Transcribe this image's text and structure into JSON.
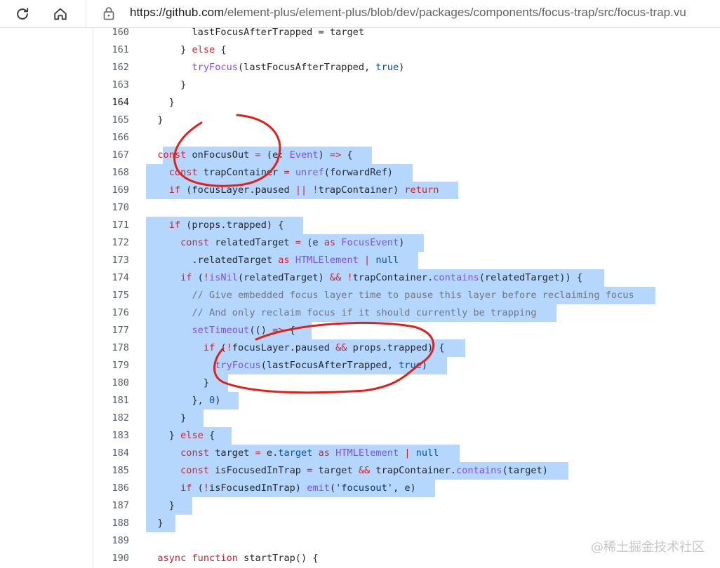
{
  "browser": {
    "url_host": "https://github.com",
    "url_path": "/element-plus/element-plus/blob/dev/packages/components/focus-trap/src/focus-trap.vu",
    "icons": {
      "reload": "reload-icon",
      "home": "home-icon",
      "lock": "lock-icon"
    }
  },
  "code": {
    "lines": [
      {
        "n": "160",
        "tokens": [
          [
            "",
            "        lastFocusAfterTrapped = target"
          ]
        ]
      },
      {
        "n": "161",
        "tokens": [
          [
            "",
            "      } "
          ],
          [
            "kw",
            "else"
          ],
          [
            "",
            " {"
          ]
        ]
      },
      {
        "n": "162",
        "tokens": [
          [
            "",
            "        "
          ],
          [
            "fn",
            "tryFocus"
          ],
          [
            "",
            "(lastFocusAfterTrapped, "
          ],
          [
            "ct",
            "true"
          ],
          [
            "",
            ")"
          ]
        ]
      },
      {
        "n": "163",
        "tokens": [
          [
            "",
            "      }"
          ]
        ]
      },
      {
        "n": "164",
        "current": true,
        "tokens": [
          [
            "",
            "    }"
          ]
        ]
      },
      {
        "n": "165",
        "tokens": [
          [
            "",
            "  }"
          ]
        ]
      },
      {
        "n": "166",
        "tokens": []
      },
      {
        "n": "167",
        "hl": [
          232,
          530
        ],
        "tokens": [
          [
            "",
            "  "
          ],
          [
            "kw",
            "const"
          ],
          [
            "",
            " onFocusOut "
          ],
          [
            "kw",
            "="
          ],
          [
            "",
            " (e: "
          ],
          [
            "fn",
            "Event"
          ],
          [
            "",
            ") "
          ],
          [
            "kw",
            "=>"
          ],
          [
            "",
            " {"
          ]
        ]
      },
      {
        "n": "168",
        "hl": [
          208,
          588
        ],
        "tokens": [
          [
            "",
            "    "
          ],
          [
            "kw",
            "const"
          ],
          [
            "",
            " trapContainer "
          ],
          [
            "kw",
            "="
          ],
          [
            "",
            " "
          ],
          [
            "fn",
            "unref"
          ],
          [
            "",
            "(forwardRef)"
          ]
        ]
      },
      {
        "n": "169",
        "hl": [
          208,
          653
        ],
        "tokens": [
          [
            "",
            "    "
          ],
          [
            "kw",
            "if"
          ],
          [
            "",
            " (focusLayer.paused "
          ],
          [
            "kw",
            "||"
          ],
          [
            "",
            " "
          ],
          [
            "kw",
            "!"
          ],
          [
            "",
            "trapContainer) "
          ],
          [
            "kw",
            "return"
          ]
        ]
      },
      {
        "n": "170",
        "tokens": []
      },
      {
        "n": "171",
        "hl": [
          208,
          432
        ],
        "tokens": [
          [
            "",
            "    "
          ],
          [
            "kw",
            "if"
          ],
          [
            "",
            " (props.trapped) {"
          ]
        ]
      },
      {
        "n": "172",
        "hl": [
          208,
          604
        ],
        "tokens": [
          [
            "",
            "      "
          ],
          [
            "kw",
            "const"
          ],
          [
            "",
            " relatedTarget "
          ],
          [
            "kw",
            "="
          ],
          [
            "",
            " (e "
          ],
          [
            "kw",
            "as"
          ],
          [
            "",
            " "
          ],
          [
            "fn",
            "FocusEvent"
          ],
          [
            "",
            ")"
          ]
        ]
      },
      {
        "n": "173",
        "hl": [
          208,
          596
        ],
        "tokens": [
          [
            "",
            "        .relatedTarget "
          ],
          [
            "kw",
            "as"
          ],
          [
            "",
            " "
          ],
          [
            "fn",
            "HTMLElement"
          ],
          [
            "",
            " "
          ],
          [
            "kw",
            "|"
          ],
          [
            "",
            " "
          ],
          [
            "ct",
            "null"
          ]
        ]
      },
      {
        "n": "174",
        "hl": [
          208,
          861
        ],
        "tokens": [
          [
            "",
            "      "
          ],
          [
            "kw",
            "if"
          ],
          [
            "",
            " ("
          ],
          [
            "kw",
            "!"
          ],
          [
            "fn",
            "isNil"
          ],
          [
            "",
            "(relatedTarget) "
          ],
          [
            "kw",
            "&&"
          ],
          [
            "",
            " "
          ],
          [
            "kw",
            "!"
          ],
          [
            "",
            "trapContainer."
          ],
          [
            "fn",
            "contains"
          ],
          [
            "",
            "(relatedTarget)) {"
          ]
        ]
      },
      {
        "n": "175",
        "hl": [
          208,
          934
        ],
        "tokens": [
          [
            "cm",
            "        // Give embedded focus layer time to pause this layer before reclaiming focus"
          ]
        ]
      },
      {
        "n": "176",
        "hl": [
          208,
          793
        ],
        "tokens": [
          [
            "cm",
            "        // And only reclaim focus if it should currently be trapping"
          ]
        ]
      },
      {
        "n": "177",
        "hl": [
          208,
          444
        ],
        "tokens": [
          [
            "",
            "        "
          ],
          [
            "fn",
            "setTimeout"
          ],
          [
            "",
            "(() "
          ],
          [
            "kw",
            "=>"
          ],
          [
            "",
            " {"
          ]
        ]
      },
      {
        "n": "178",
        "hl": [
          208,
          663
        ],
        "tokens": [
          [
            "",
            "          "
          ],
          [
            "kw",
            "if"
          ],
          [
            "",
            " ("
          ],
          [
            "kw",
            "!"
          ],
          [
            "",
            "focusLayer.paused "
          ],
          [
            "kw",
            "&&"
          ],
          [
            "",
            " props.trapped) {"
          ]
        ]
      },
      {
        "n": "179",
        "hl": [
          208,
          637
        ],
        "tokens": [
          [
            "",
            "            "
          ],
          [
            "fn",
            "tryFocus"
          ],
          [
            "",
            "(lastFocusAfterTrapped, "
          ],
          [
            "ct",
            "true"
          ],
          [
            "",
            ")"
          ]
        ]
      },
      {
        "n": "180",
        "hl": [
          208,
          325
        ],
        "tokens": [
          [
            "",
            "          }"
          ]
        ]
      },
      {
        "n": "181",
        "hl": [
          208,
          340
        ],
        "tokens": [
          [
            "",
            "        }, "
          ],
          [
            "ct",
            "0"
          ],
          [
            "",
            ")"
          ]
        ]
      },
      {
        "n": "182",
        "hl": [
          208,
          290
        ],
        "tokens": [
          [
            "",
            "      }"
          ]
        ]
      },
      {
        "n": "183",
        "hl": [
          208,
          330
        ],
        "tokens": [
          [
            "",
            "    } "
          ],
          [
            "kw",
            "else"
          ],
          [
            "",
            " {"
          ]
        ]
      },
      {
        "n": "184",
        "hl": [
          208,
          655
        ],
        "tokens": [
          [
            "",
            "      "
          ],
          [
            "kw",
            "const"
          ],
          [
            "",
            " target "
          ],
          [
            "kw",
            "="
          ],
          [
            "",
            " e."
          ],
          [
            "ct",
            "target"
          ],
          [
            "",
            " "
          ],
          [
            "kw",
            "as"
          ],
          [
            "",
            " "
          ],
          [
            "fn",
            "HTMLElement"
          ],
          [
            "",
            " "
          ],
          [
            "kw",
            "|"
          ],
          [
            "",
            " "
          ],
          [
            "ct",
            "null"
          ]
        ]
      },
      {
        "n": "185",
        "hl": [
          208,
          810
        ],
        "tokens": [
          [
            "",
            "      "
          ],
          [
            "kw",
            "const"
          ],
          [
            "",
            " isFocusedInTrap "
          ],
          [
            "kw",
            "="
          ],
          [
            "",
            " target "
          ],
          [
            "kw",
            "&&"
          ],
          [
            "",
            " trapContainer."
          ],
          [
            "fn",
            "contains"
          ],
          [
            "",
            "(target)"
          ]
        ]
      },
      {
        "n": "186",
        "hl": [
          208,
          620
        ],
        "tokens": [
          [
            "",
            "      "
          ],
          [
            "kw",
            "if"
          ],
          [
            "",
            " ("
          ],
          [
            "kw",
            "!"
          ],
          [
            "",
            "isFocusedInTrap) "
          ],
          [
            "fn",
            "emit"
          ],
          [
            "",
            "("
          ],
          [
            "st",
            "'focusout'"
          ],
          [
            "",
            ", e)"
          ]
        ]
      },
      {
        "n": "187",
        "hl": [
          208,
          274
        ],
        "tokens": [
          [
            "",
            "    }"
          ]
        ]
      },
      {
        "n": "188",
        "hl": [
          208,
          250
        ],
        "tokens": [
          [
            "",
            "  }"
          ]
        ]
      },
      {
        "n": "189",
        "tokens": []
      },
      {
        "n": "190",
        "tokens": [
          [
            "",
            "  "
          ],
          [
            "kw",
            "async"
          ],
          [
            "",
            " "
          ],
          [
            "kw",
            "function"
          ],
          [
            "",
            " startTrap() {"
          ]
        ]
      }
    ]
  },
  "watermark": "@稀土掘金技术社区",
  "colors": {
    "selection": "#b5d7fd",
    "annotation": "#e0201b"
  }
}
